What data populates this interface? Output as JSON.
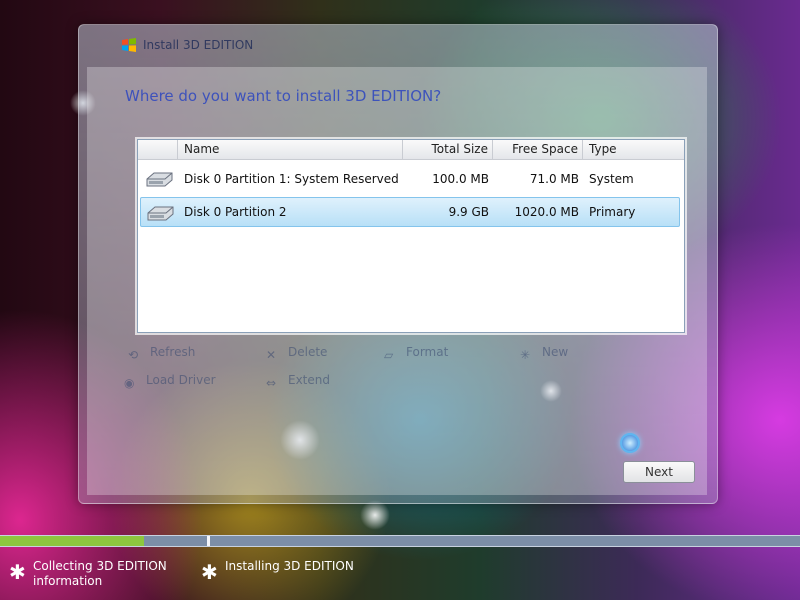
{
  "window": {
    "title": "Install 3D EDITION",
    "question": "Where do you want to install 3D EDITION?"
  },
  "table": {
    "columns": [
      "Name",
      "Total Size",
      "Free Space",
      "Type"
    ],
    "rows": [
      {
        "name": "Disk 0 Partition 1: System Reserved",
        "total": "100.0 MB",
        "free": "71.0 MB",
        "type": "System",
        "selected": false
      },
      {
        "name": "Disk 0 Partition 2",
        "total": "9.9 GB",
        "free": "1020.0 MB",
        "type": "Primary",
        "selected": true
      }
    ]
  },
  "actions": {
    "refresh": "Refresh",
    "delete": "Delete",
    "format": "Format",
    "new": "New",
    "load_driver": "Load Driver",
    "extend": "Extend"
  },
  "buttons": {
    "next": "Next"
  },
  "progress": {
    "fill_percent": 18,
    "steps": [
      {
        "label_line1": "Collecting 3D EDITION",
        "label_line2": "information"
      },
      {
        "label_line1": "Installing 3D EDITION"
      }
    ]
  },
  "colors": {
    "progress_fill": "#8dc63f",
    "selected_row": "#b8e0f7",
    "question_text": "#2d46c0"
  }
}
